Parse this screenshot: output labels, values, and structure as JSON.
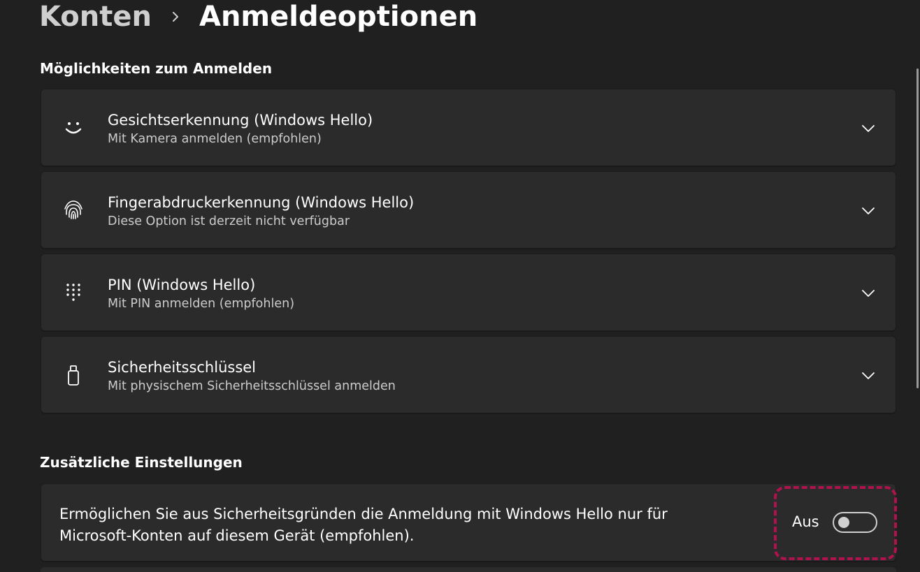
{
  "breadcrumb": {
    "parent": "Konten",
    "current": "Anmeldeoptionen"
  },
  "sections": {
    "signin_title": "Möglichkeiten zum Anmelden",
    "additional_title": "Zusätzliche Einstellungen"
  },
  "options": [
    {
      "icon": "face-smile-icon",
      "title": "Gesichtserkennung (Windows Hello)",
      "subtitle": "Mit Kamera anmelden (empfohlen)"
    },
    {
      "icon": "fingerprint-icon",
      "title": "Fingerabdruckerkennung (Windows Hello)",
      "subtitle": "Diese Option ist derzeit nicht verfügbar"
    },
    {
      "icon": "pin-keypad-icon",
      "title": "PIN (Windows Hello)",
      "subtitle": "Mit PIN anmelden (empfohlen)"
    },
    {
      "icon": "security-key-icon",
      "title": "Sicherheitsschlüssel",
      "subtitle": "Mit physischem Sicherheitsschlüssel anmelden"
    }
  ],
  "additional": {
    "hello_only_text": "Ermöglichen Sie aus Sicherheitsgründen die Anmeldung mit Windows Hello nur für Microsoft-Konten auf diesem Gerät (empfohlen).",
    "toggle_label": "Aus",
    "toggle_on": false
  },
  "colors": {
    "background": "#202020",
    "card": "#2b2b2b",
    "highlight_dashed": "#b0124e"
  }
}
